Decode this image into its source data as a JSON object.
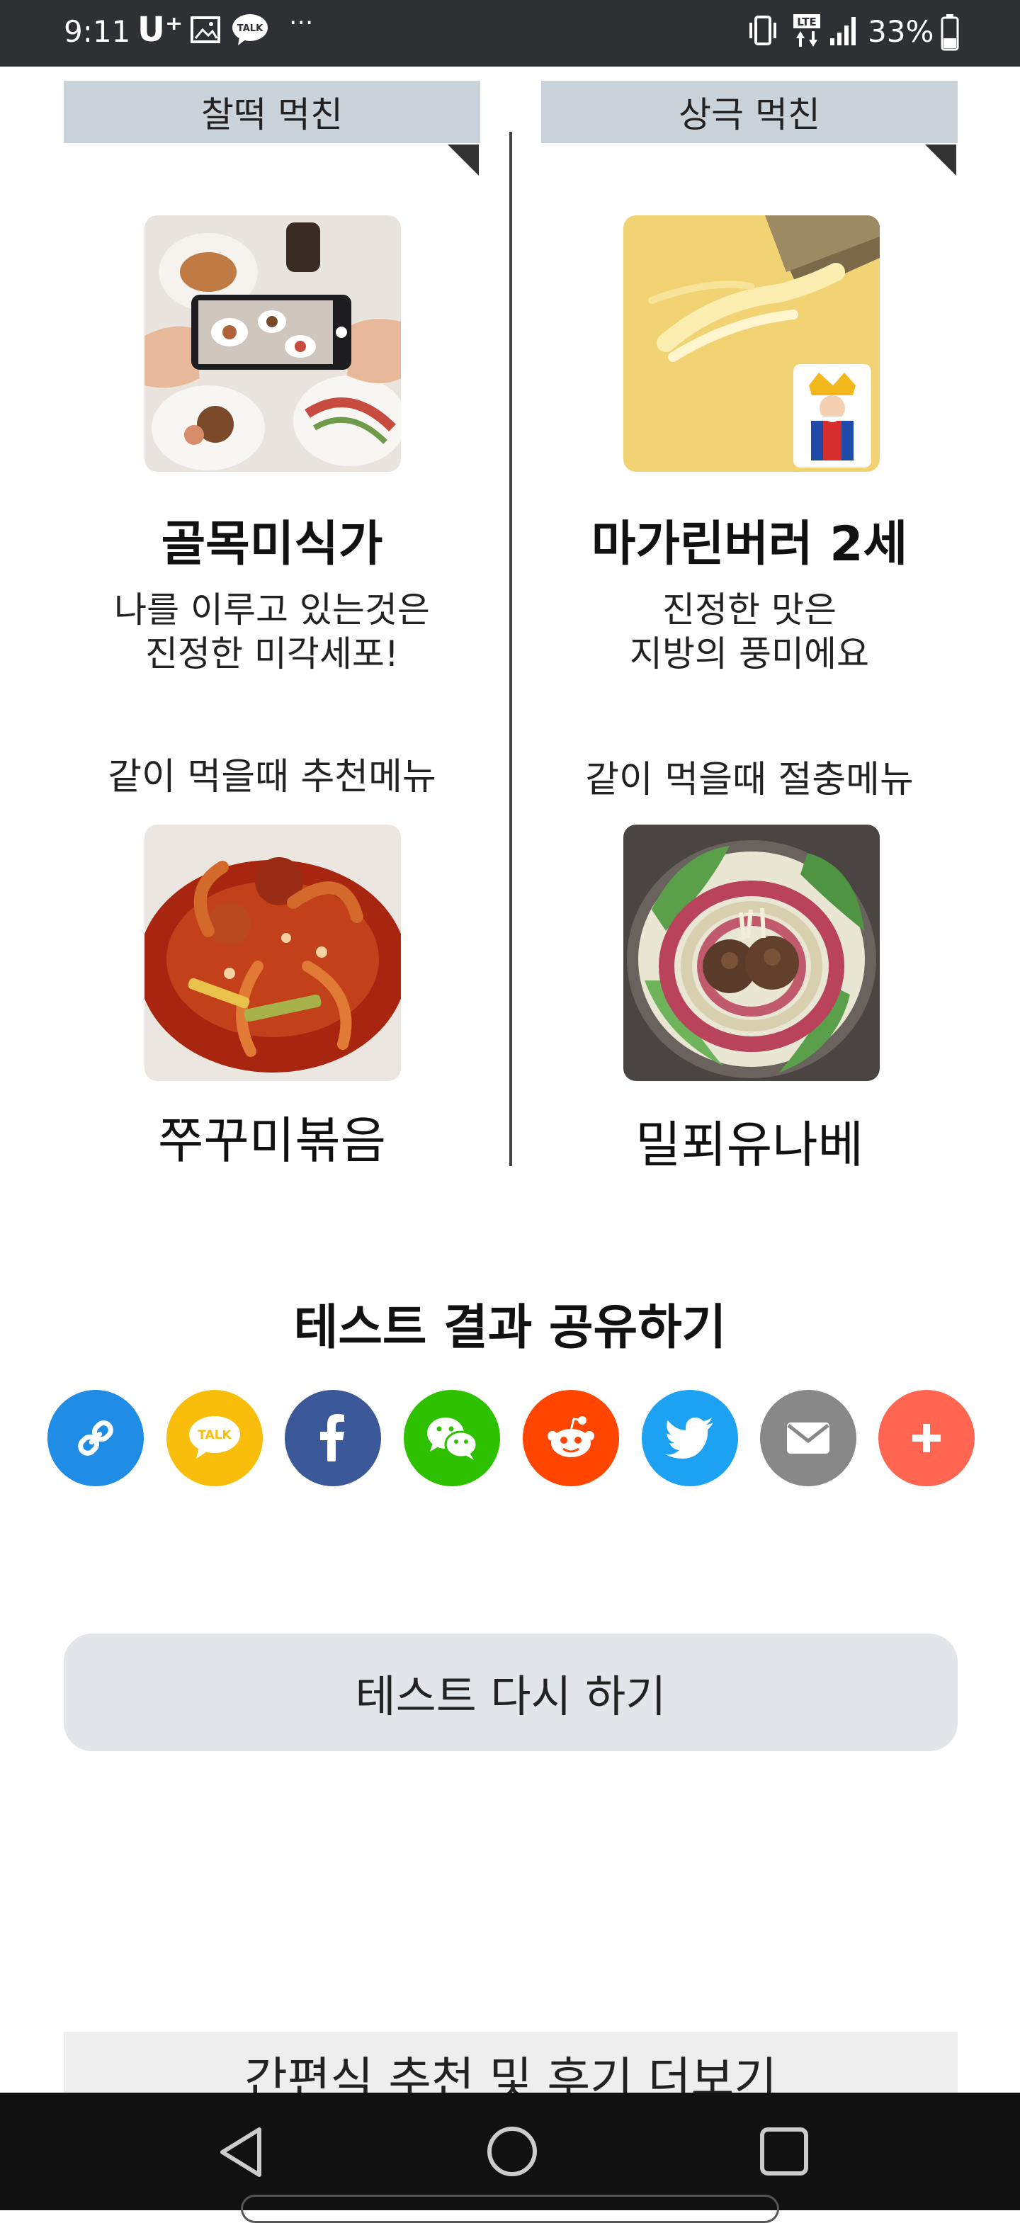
{
  "status_bar": {
    "time": "9:11",
    "carrier": "U⁺",
    "more": "···",
    "battery": "33%",
    "icons": [
      "gallery-icon",
      "kakaotalk-icon",
      "vibrate-icon",
      "lte-icon",
      "signal-icon",
      "battery-icon"
    ]
  },
  "left": {
    "tag": "찰떡 먹친",
    "image": "food-photo-image",
    "name": "골목미식가",
    "desc_line1": "나를 이루고 있는것은",
    "desc_line2": "진정한 미각세포!",
    "rec_label": "같이 먹을때 추천메뉴",
    "menu_image": "spicy-squid-image",
    "menu_name": "쭈꾸미볶음"
  },
  "right": {
    "tag": "상극 먹친",
    "image": "margarine-king-image",
    "name": "마가린버러 2세",
    "desc_line1": "진정한 맛은",
    "desc_line2": "지방의 풍미에요",
    "rec_label": "같이 먹을때 절충메뉴",
    "menu_image": "millefeuille-nabe-image",
    "menu_name": "밀푀유나베"
  },
  "share": {
    "title": "테스트 결과 공유하기",
    "buttons": [
      {
        "name": "link",
        "color": "#1f8ce6"
      },
      {
        "name": "kakaotalk",
        "color": "#f9be0c",
        "label": "TALK"
      },
      {
        "name": "facebook",
        "color": "#3b5998"
      },
      {
        "name": "wechat",
        "color": "#2dc100"
      },
      {
        "name": "reddit",
        "color": "#ff4500"
      },
      {
        "name": "twitter",
        "color": "#1da1f2"
      },
      {
        "name": "email",
        "color": "#888888"
      },
      {
        "name": "more",
        "color": "#ff6550"
      }
    ]
  },
  "retry_label": "테스트 다시 하기",
  "more_label": "간편식 추천 및 후기 더보기"
}
